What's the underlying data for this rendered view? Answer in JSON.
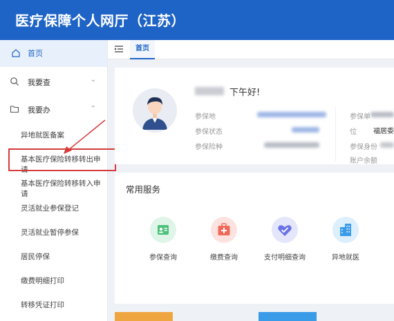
{
  "header": {
    "title": "医疗保障个人网厅（江苏）"
  },
  "tabs": {
    "home": "首页"
  },
  "sidebar": {
    "home": "首页",
    "query": "我要查",
    "handle": "我要办",
    "sub_items": [
      "异地就医备案",
      "基本医疗保险转移转出申请",
      "基本医疗保险转移转入申请",
      "灵活就业参保登记",
      "灵活就业暂停参保",
      "居民停保",
      "缴费明细打印",
      "转移凭证打印"
    ]
  },
  "user_card": {
    "greeting": "下午好!",
    "labels": [
      "参保地",
      "参保状态",
      "参保险种"
    ],
    "right_labels": [
      "参保单",
      "位",
      "参保身份",
      "账户余额"
    ],
    "right_value": "福居委"
  },
  "services": {
    "title": "常用服务",
    "items": [
      {
        "label": "参保查询",
        "icon": "id-card-icon",
        "color": "#4cc17a"
      },
      {
        "label": "缴费查询",
        "icon": "medical-kit-icon",
        "color": "#f06a5a"
      },
      {
        "label": "支付明细查询",
        "icon": "heart-check-icon",
        "color": "#6a73e8"
      },
      {
        "label": "异地就医",
        "icon": "building-icon",
        "color": "#3a9be8"
      }
    ]
  }
}
